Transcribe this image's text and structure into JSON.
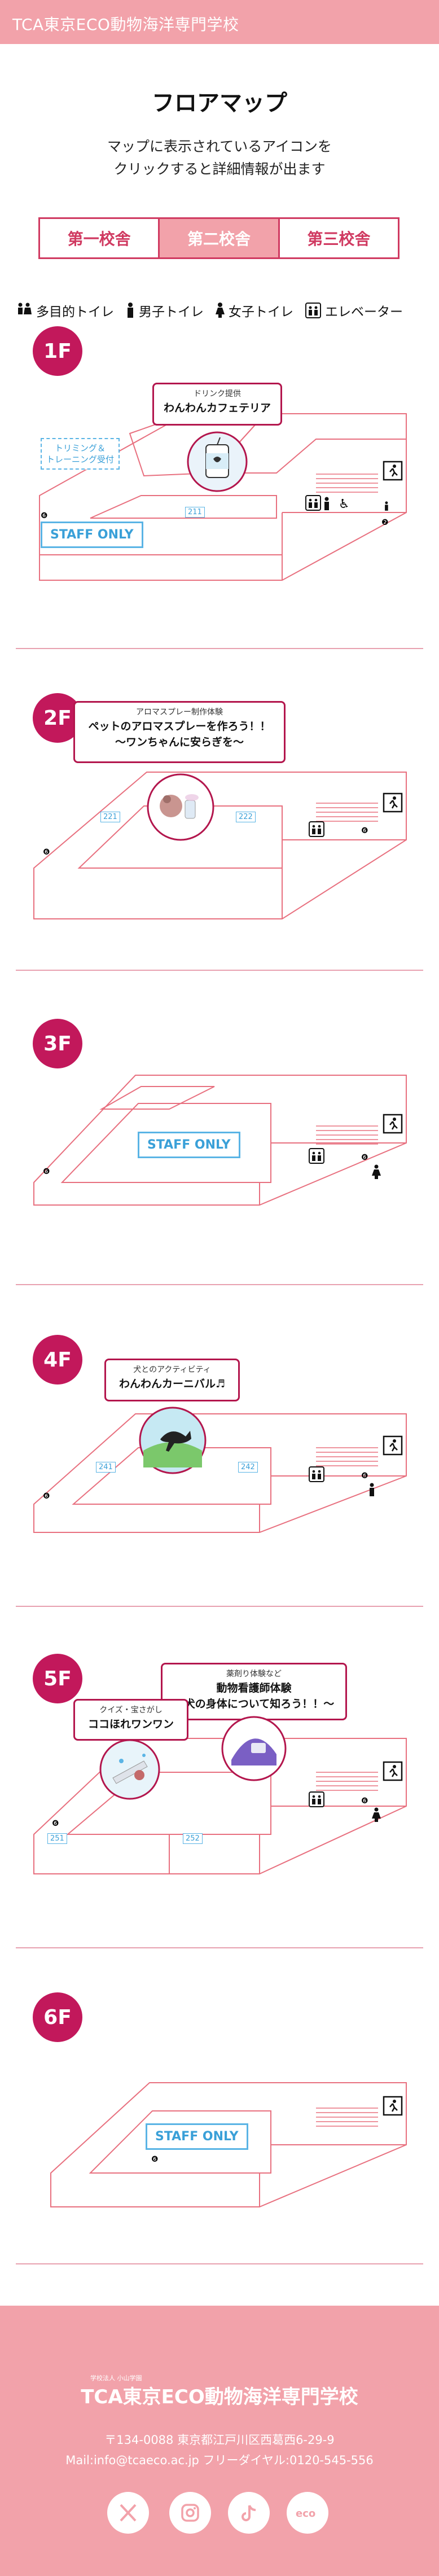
{
  "header": {
    "brand": "TCA東京ECO動物海洋専門学校"
  },
  "title": "フロアマップ",
  "lead": [
    "マップに表示されているアイコンを",
    "クリックすると詳細情報が出ます"
  ],
  "tabs": [
    "第一校舎",
    "第二校舎",
    "第三校舎"
  ],
  "active_tab": 1,
  "legend": [
    "多目的トイレ",
    "男子トイレ",
    "女子トイレ",
    "エレベーター"
  ],
  "floors": {
    "f1": {
      "label": "1F",
      "callout_sub": "ドリンク提供",
      "callout_main": "わんわんカフェテリア",
      "trimming": [
        "トリミング＆",
        "トレーニング受付"
      ],
      "staff": "STAFF ONLY",
      "room": "211"
    },
    "f2": {
      "label": "2F",
      "callout_sub": "アロマスプレー制作体験",
      "callout_main": [
        "ペットのアロマスプレーを作ろう！！",
        "〜ワンちゃんに安らぎを〜"
      ],
      "rooms": [
        "221",
        "222"
      ]
    },
    "f3": {
      "label": "3F",
      "staff": "STAFF ONLY"
    },
    "f4": {
      "label": "4F",
      "callout_sub": "犬とのアクティビティ",
      "callout_main": "わんわんカーニバル♬",
      "rooms": [
        "241",
        "242"
      ]
    },
    "f5": {
      "label": "5F",
      "callout1_sub": "クイズ・宝さがし",
      "callout1_main": "ココほれワンワン",
      "callout2_sub": "薬剤り体験など",
      "callout2_main": [
        "動物看護師体験",
        "〜犬の身体について知ろう！！〜"
      ],
      "rooms": [
        "251",
        "252"
      ]
    },
    "f6": {
      "label": "6F",
      "staff": "STAFF ONLY"
    }
  },
  "footer": {
    "logo_sub": "学校法人 小山学園",
    "logo": "TCA東京ECO動物海洋専門学校",
    "address": "〒134-0088 東京都江戸川区西葛西6-29-9",
    "contact": "Mail:info@tcaeco.ac.jp フリーダイヤル:0120-545-556",
    "sns": [
      "x-icon",
      "instagram-icon",
      "tiktok-icon",
      "eco-icon"
    ]
  },
  "colors": {
    "accent": "#c2185b",
    "pink": "#f2a2aa",
    "line": "#e8707f",
    "blue": "#5ab4e5"
  }
}
